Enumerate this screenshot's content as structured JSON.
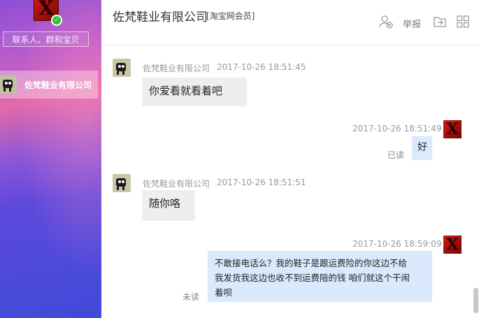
{
  "sidebar": {
    "search_placeholder": "联系人、群和宝贝",
    "contacts": [
      {
        "name": "佐梵鞋业有限公司",
        "active": true
      }
    ]
  },
  "header": {
    "title": "佐梵鞋业有限公司",
    "badge": "[淘宝网会员]",
    "report_label": "举报"
  },
  "messages": [
    {
      "sender": "佐梵鞋业有限公司",
      "time": "2017-10-26 18:51:45",
      "text": "你爱看就看着吧",
      "self": false
    },
    {
      "time": "2017-10-26 18:51:49",
      "text": "好",
      "self": true,
      "status": "已读"
    },
    {
      "sender": "佐梵鞋业有限公司",
      "time": "2017-10-26 18:51:51",
      "text": "随你咯",
      "self": false
    },
    {
      "time": "2017-10-26 18:59:09",
      "text": "不敢接电话么？我的鞋子是跟运费险的你这边不给\n我发货我这边也收不到运费陪的钱 咱们就这个干闹\n着呗",
      "self": true,
      "status": "未读"
    }
  ],
  "colors": {
    "self_bubble": "#daeafc",
    "other_bubble": "#eeeeee",
    "online": "#2fbf3a"
  }
}
